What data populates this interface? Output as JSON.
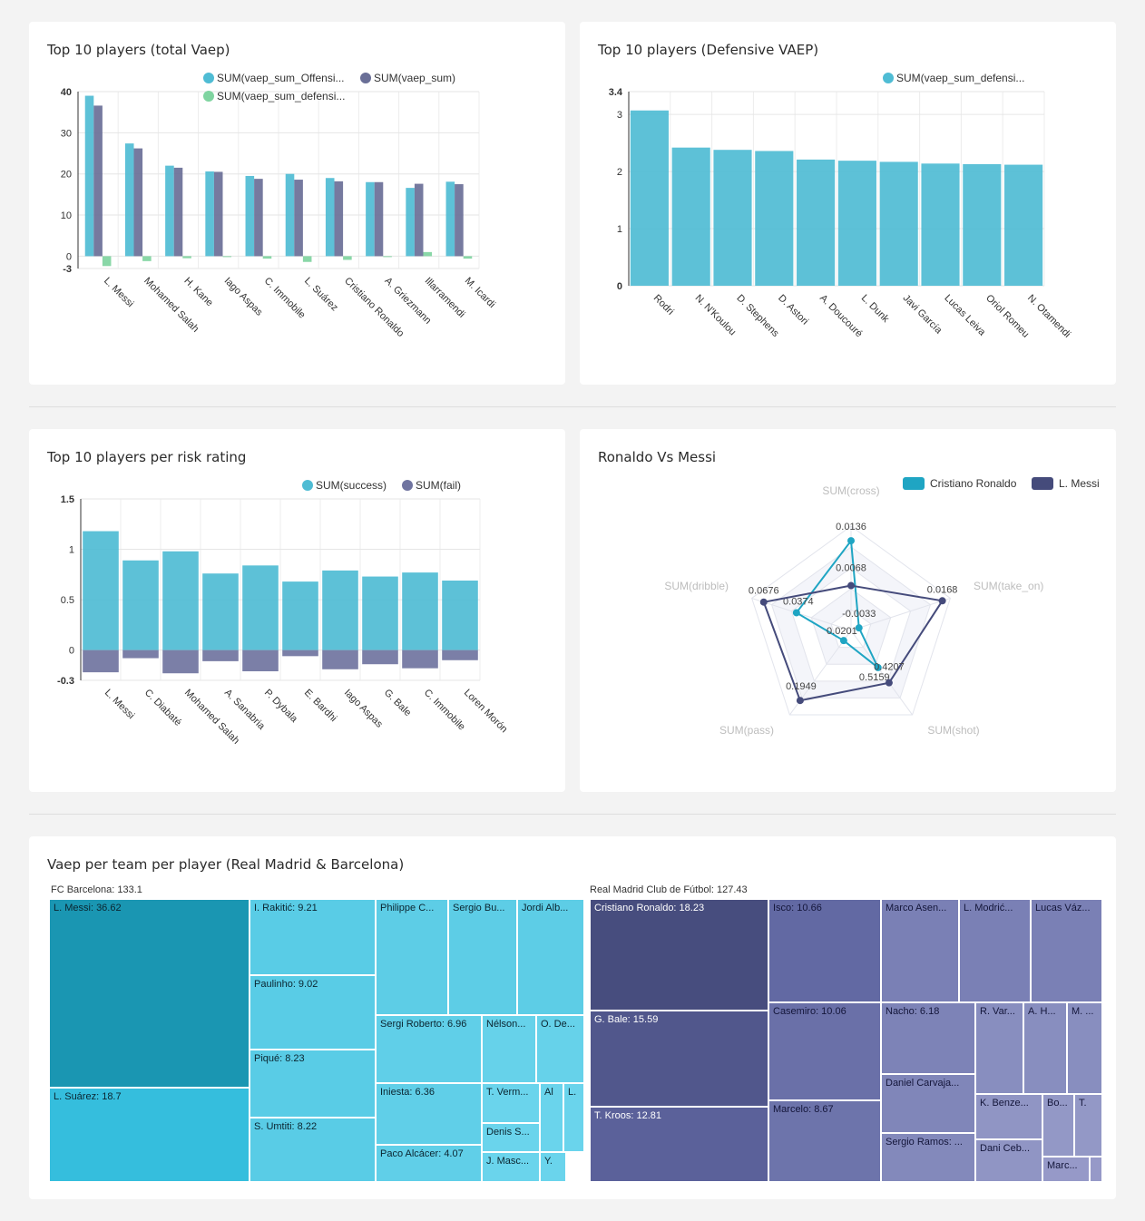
{
  "card1": {
    "title": "Top 10 players (total Vaep)"
  },
  "card2": {
    "title": "Top 10 players (Defensive VAEP)"
  },
  "card3": {
    "title": "Top 10 players per risk rating"
  },
  "card4": {
    "title": "Ronaldo Vs Messi"
  },
  "card5": {
    "title": "Vaep per team per player (Real Madrid & Barcelona)"
  },
  "colors": {
    "offensive": "#4fbcd4",
    "total": "#6a6f97",
    "defensive": "#7fd4a0",
    "fail": "#7074a0",
    "ronaldo": "#1fa5c3",
    "messi": "#454b7b"
  },
  "chart_data": [
    {
      "type": "bar",
      "title": "Top 10 players (total Vaep)",
      "categories": [
        "L. Messi",
        "Mohamed Salah",
        "H. Kane",
        "Iago Aspas",
        "C. Immobile",
        "L. Suárez",
        "Cristiano Ronaldo",
        "A. Griezmann",
        "Illarramendi",
        "M. Icardi"
      ],
      "series": [
        {
          "name": "SUM(vaep_sum_Offensi...",
          "color": "#4fbcd4",
          "values": [
            39.0,
            27.4,
            22.0,
            20.6,
            19.5,
            20.0,
            19.0,
            18.0,
            16.6,
            18.1
          ]
        },
        {
          "name": "SUM(vaep_sum)",
          "color": "#6a6f97",
          "values": [
            36.6,
            26.2,
            21.5,
            20.5,
            18.8,
            18.6,
            18.2,
            18.0,
            17.6,
            17.5
          ]
        },
        {
          "name": "SUM(vaep_sum_defensi...",
          "color": "#7fd4a0",
          "values": [
            -2.4,
            -1.2,
            -0.5,
            -0.2,
            -0.6,
            -1.4,
            -0.9,
            -0.1,
            1.0,
            -0.6
          ]
        }
      ],
      "ylim": [
        -3,
        40
      ],
      "yticks": [
        40,
        30,
        20,
        10,
        0,
        -3
      ],
      "legend": "top"
    },
    {
      "type": "bar",
      "title": "Top 10 players (Defensive VAEP)",
      "categories": [
        "Rodri",
        "N. N'Koulou",
        "D. Stephens",
        "D. Astori",
        "A. Doucouré",
        "L. Dunk",
        "Javi García",
        "Lucas Leiva",
        "Oriol Romeu",
        "N. Otamendi"
      ],
      "series": [
        {
          "name": "SUM(vaep_sum_defensi...",
          "color": "#4fbcd4",
          "values": [
            3.07,
            2.42,
            2.38,
            2.36,
            2.21,
            2.19,
            2.17,
            2.14,
            2.13,
            2.12
          ]
        }
      ],
      "ylim": [
        0,
        3.4
      ],
      "yticks": [
        3.4,
        3,
        2,
        1,
        0
      ],
      "legend": "top"
    },
    {
      "type": "bar",
      "title": "Top 10 players per risk rating",
      "categories": [
        "L. Messi",
        "C. Diabaté",
        "Mohamed Salah",
        "A. Sanabria",
        "P. Dybala",
        "E. Bardhi",
        "Iago Aspas",
        "G. Bale",
        "C. Immobile",
        "Loren Morón"
      ],
      "series": [
        {
          "name": "SUM(success)",
          "color": "#4fbcd4",
          "values": [
            1.18,
            0.89,
            0.98,
            0.76,
            0.84,
            0.68,
            0.79,
            0.73,
            0.77,
            0.69
          ]
        },
        {
          "name": "SUM(fail)",
          "color": "#7074a0",
          "values": [
            -0.22,
            -0.08,
            -0.23,
            -0.11,
            -0.21,
            -0.06,
            -0.19,
            -0.14,
            -0.18,
            -0.1
          ]
        }
      ],
      "ylim": [
        -0.3,
        1.5
      ],
      "yticks": [
        1.5,
        1,
        0.5,
        0,
        -0.3
      ],
      "legend": "top"
    },
    {
      "type": "radar",
      "title": "Ronaldo Vs Messi",
      "indicators": [
        "SUM(cross)",
        "SUM(take_on)",
        "SUM(shot)",
        "SUM(pass)",
        "SUM(dribble)"
      ],
      "series": [
        {
          "name": "Cristiano Ronaldo",
          "color": "#1fa5c3",
          "values": [
            0.0136,
            -0.0033,
            0.5159,
            0.0201,
            0.0374
          ],
          "fractions": [
            0.86,
            0.08,
            0.44,
            0.12,
            0.55
          ],
          "labels": [
            "0.0136",
            "-0.0033",
            "0.5159",
            "0.0201",
            "0.0374"
          ]
        },
        {
          "name": "L. Messi",
          "color": "#454b7b",
          "values": [
            0.0068,
            0.0168,
            0.4207,
            0.1949,
            0.0676
          ],
          "fractions": [
            0.43,
            0.92,
            0.62,
            0.83,
            0.88
          ],
          "labels": [
            "0.0068",
            "0.0168",
            "0.4207",
            "0.1949",
            "0.0676"
          ]
        }
      ],
      "legend": "top-right"
    },
    {
      "type": "treemap",
      "title": "Vaep per team per player (Real Madrid & Barcelona)",
      "groups": [
        {
          "label": "FC Barcelona: 133.1",
          "team": "FC Barcelona",
          "total": 133.1,
          "children": [
            {
              "label": "L. Messi: 36.62",
              "value": 36.62
            },
            {
              "label": "L. Suárez: 18.7",
              "value": 18.7
            },
            {
              "label": "I. Rakitić: 9.21",
              "value": 9.21
            },
            {
              "label": "Paulinho: 9.02",
              "value": 9.02
            },
            {
              "label": "Piqué: 8.23",
              "value": 8.23
            },
            {
              "label": "S. Umtiti: 8.22",
              "value": 8.22
            },
            {
              "label": "Philippe C...",
              "value": null
            },
            {
              "label": "Sergio Bu...",
              "value": null
            },
            {
              "label": "Jordi Alb...",
              "value": null
            },
            {
              "label": "Sergi Roberto: 6.96",
              "value": 6.96
            },
            {
              "label": "Nélson...",
              "value": null
            },
            {
              "label": "O. De...",
              "value": null
            },
            {
              "label": "Iniesta: 6.36",
              "value": 6.36
            },
            {
              "label": "T. Verm...",
              "value": null
            },
            {
              "label": "Al",
              "value": null
            },
            {
              "label": "L.",
              "value": null
            },
            {
              "label": "Denis S...",
              "value": null
            },
            {
              "label": "Paco Alcácer: 4.07",
              "value": 4.07
            },
            {
              "label": "Y.",
              "value": null
            },
            {
              "label": "J. Masc...",
              "value": null
            }
          ]
        },
        {
          "label": "Real Madrid Club de Fútbol: 127.43",
          "team": "Real Madrid Club de Fútbol",
          "total": 127.43,
          "children": [
            {
              "label": "Cristiano Ronaldo: 18.23",
              "value": 18.23
            },
            {
              "label": "G. Bale: 15.59",
              "value": 15.59
            },
            {
              "label": "T. Kroos: 12.81",
              "value": 12.81
            },
            {
              "label": "Isco: 10.66",
              "value": 10.66
            },
            {
              "label": "Casemiro: 10.06",
              "value": 10.06
            },
            {
              "label": "Marcelo: 8.67",
              "value": 8.67
            },
            {
              "label": "Marco Asen...",
              "value": null
            },
            {
              "label": "L. Modrić...",
              "value": null
            },
            {
              "label": "Lucas Váz...",
              "value": null
            },
            {
              "label": "Nacho: 6.18",
              "value": 6.18
            },
            {
              "label": "R. Var...",
              "value": null
            },
            {
              "label": "A. H...",
              "value": null
            },
            {
              "label": "M. ...",
              "value": null
            },
            {
              "label": "Daniel Carvaja...",
              "value": null
            },
            {
              "label": "K. Benze...",
              "value": null
            },
            {
              "label": "Bo...",
              "value": null
            },
            {
              "label": "T.",
              "value": null
            },
            {
              "label": "Sergio Ramos: ...",
              "value": null
            },
            {
              "label": "Dani Ceb...",
              "value": null
            },
            {
              "label": "Marc...",
              "value": null
            },
            {
              "label": "",
              "value": null
            }
          ]
        }
      ]
    }
  ]
}
